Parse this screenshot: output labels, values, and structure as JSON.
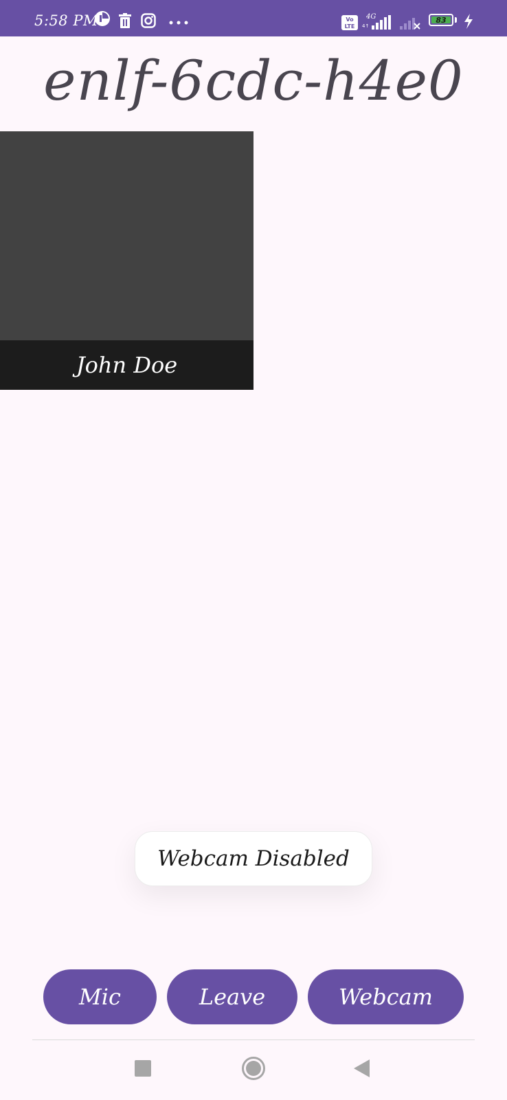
{
  "status_bar": {
    "time": "5:58 PM",
    "network_label": "4G",
    "volte_label": "Vo LTE",
    "battery_percent": "83",
    "icons": [
      "app-notification-icon",
      "delete-icon",
      "instagram-icon",
      "more-dots-icon",
      "volte-icon",
      "signal-icon",
      "no-signal-icon",
      "battery-icon",
      "charging-icon"
    ]
  },
  "meeting": {
    "id": "enlf-6cdc-h4e0"
  },
  "participants": [
    {
      "name": "John Doe"
    }
  ],
  "toast": {
    "message": "Webcam Disabled"
  },
  "controls": {
    "mic_label": "Mic",
    "leave_label": "Leave",
    "webcam_label": "Webcam"
  },
  "nav_bar": {
    "icons": [
      "recents-square-icon",
      "home-circle-icon",
      "back-triangle-icon"
    ]
  },
  "colors": {
    "primary": "#6750a4",
    "background": "#fef7fc",
    "tile": "#424242",
    "tile_label_bar": "#1c1c1c",
    "battery": "#4caf50"
  }
}
